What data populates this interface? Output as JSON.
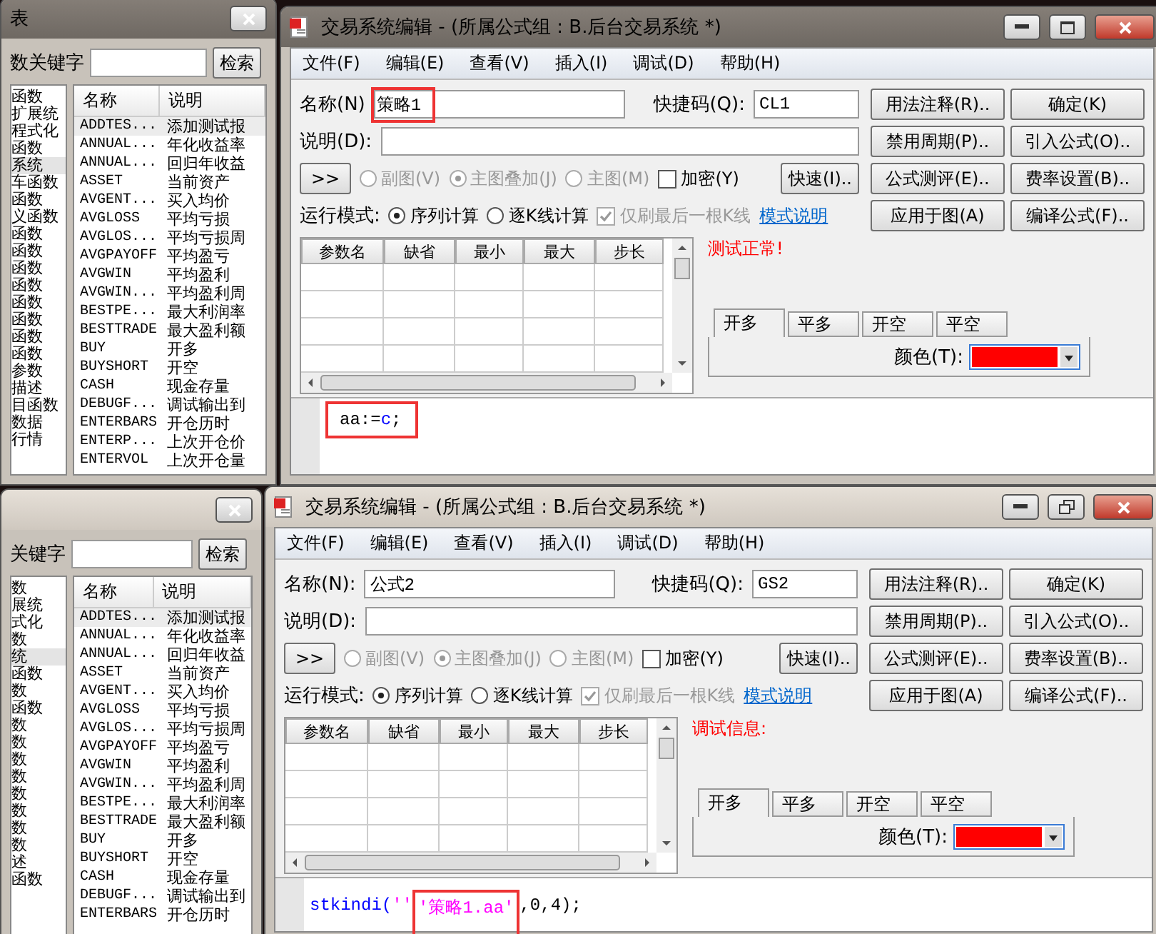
{
  "function_panels": [
    {
      "title": "表",
      "search_label": "数关键字",
      "search_button": "检索",
      "tree_items": [
        {
          "label": "函数",
          "selected": false
        },
        {
          "label": "扩展统",
          "selected": false
        },
        {
          "label": "程式化",
          "selected": false
        },
        {
          "label": "函数",
          "selected": false
        },
        {
          "label": "系统",
          "selected": true
        },
        {
          "label": "车函数",
          "selected": false
        },
        {
          "label": "函数",
          "selected": false
        },
        {
          "label": "义函数",
          "selected": false
        },
        {
          "label": "函数",
          "selected": false
        },
        {
          "label": "函数",
          "selected": false
        },
        {
          "label": "函数",
          "selected": false
        },
        {
          "label": "函数",
          "selected": false
        },
        {
          "label": "函数",
          "selected": false
        },
        {
          "label": "函数",
          "selected": false
        },
        {
          "label": "函数",
          "selected": false
        },
        {
          "label": "函数",
          "selected": false
        },
        {
          "label": "参数",
          "selected": false
        },
        {
          "label": "描述",
          "selected": false
        },
        {
          "label": "目函数",
          "selected": false
        },
        {
          "label": "数据",
          "selected": false
        },
        {
          "label": "行情",
          "selected": false
        }
      ],
      "columns": [
        "名称",
        "说明"
      ],
      "rows": [
        {
          "name": "ADDTES...",
          "desc": "添加测试报",
          "selected": true
        },
        {
          "name": "ANNUAL...",
          "desc": "年化收益率",
          "selected": false
        },
        {
          "name": "ANNUAL...",
          "desc": "回归年收益",
          "selected": false
        },
        {
          "name": "ASSET",
          "desc": "当前资产",
          "selected": false
        },
        {
          "name": "AVGENT...",
          "desc": "买入均价",
          "selected": false
        },
        {
          "name": "AVGLOSS",
          "desc": "平均亏损",
          "selected": false
        },
        {
          "name": "AVGLOS...",
          "desc": "平均亏损周",
          "selected": false
        },
        {
          "name": "AVGPAYOFF",
          "desc": "平均盈亏",
          "selected": false
        },
        {
          "name": "AVGWIN",
          "desc": "平均盈利",
          "selected": false
        },
        {
          "name": "AVGWIN...",
          "desc": "平均盈利周",
          "selected": false
        },
        {
          "name": "BESTPE...",
          "desc": "最大利润率",
          "selected": false
        },
        {
          "name": "BESTTRADE",
          "desc": "最大盈利额",
          "selected": false
        },
        {
          "name": "BUY",
          "desc": "开多",
          "selected": false
        },
        {
          "name": "BUYSHORT",
          "desc": "开空",
          "selected": false
        },
        {
          "name": "CASH",
          "desc": "现金存量",
          "selected": false
        },
        {
          "name": "DEBUGF...",
          "desc": "调试输出到",
          "selected": false
        },
        {
          "name": "ENTERBARS",
          "desc": "开仓历时",
          "selected": false
        },
        {
          "name": "ENTERP...",
          "desc": "上次开仓价",
          "selected": false
        },
        {
          "name": "ENTERVOL",
          "desc": "上次开仓量",
          "selected": false
        }
      ]
    },
    {
      "search_label": "关键字",
      "search_button": "检索",
      "tree_items": [
        {
          "label": "数",
          "selected": false
        },
        {
          "label": "展统",
          "selected": false
        },
        {
          "label": "式化",
          "selected": false
        },
        {
          "label": "数",
          "selected": false
        },
        {
          "label": "统",
          "selected": true
        },
        {
          "label": "函数",
          "selected": false
        },
        {
          "label": "数",
          "selected": false
        },
        {
          "label": "函数",
          "selected": false
        },
        {
          "label": "数",
          "selected": false
        },
        {
          "label": "数",
          "selected": false
        },
        {
          "label": "数",
          "selected": false
        },
        {
          "label": "数",
          "selected": false
        },
        {
          "label": "数",
          "selected": false
        },
        {
          "label": "数",
          "selected": false
        },
        {
          "label": "数",
          "selected": false
        },
        {
          "label": "数",
          "selected": false
        },
        {
          "label": "述",
          "selected": false
        },
        {
          "label": "函数",
          "selected": false
        }
      ],
      "columns": [
        "名称",
        "说明"
      ],
      "rows": [
        {
          "name": "ADDTES...",
          "desc": "添加测试报",
          "selected": true
        },
        {
          "name": "ANNUAL...",
          "desc": "年化收益率",
          "selected": false
        },
        {
          "name": "ANNUAL...",
          "desc": "回归年收益",
          "selected": false
        },
        {
          "name": "ASSET",
          "desc": "当前资产",
          "selected": false
        },
        {
          "name": "AVGENT...",
          "desc": "买入均价",
          "selected": false
        },
        {
          "name": "AVGLOSS",
          "desc": "平均亏损",
          "selected": false
        },
        {
          "name": "AVGLOS...",
          "desc": "平均亏损周",
          "selected": false
        },
        {
          "name": "AVGPAYOFF",
          "desc": "平均盈亏",
          "selected": false
        },
        {
          "name": "AVGWIN",
          "desc": "平均盈利",
          "selected": false
        },
        {
          "name": "AVGWIN...",
          "desc": "平均盈利周",
          "selected": false
        },
        {
          "name": "BESTPE...",
          "desc": "最大利润率",
          "selected": false
        },
        {
          "name": "BESTTRADE",
          "desc": "最大盈利额",
          "selected": false
        },
        {
          "name": "BUY",
          "desc": "开多",
          "selected": false
        },
        {
          "name": "BUYSHORT",
          "desc": "开空",
          "selected": false
        },
        {
          "name": "CASH",
          "desc": "现金存量",
          "selected": false
        },
        {
          "name": "DEBUGF...",
          "desc": "调试输出到",
          "selected": false
        },
        {
          "name": "ENTERBARS",
          "desc": "开仓历时",
          "selected": false
        }
      ]
    }
  ],
  "editors": [
    {
      "title": "交易系统编辑 - (所属公式组 : B.后台交易系统 *)",
      "restore_button": false,
      "active": false,
      "menu": [
        "文件(F)",
        "编辑(E)",
        "查看(V)",
        "插入(I)",
        "调试(D)",
        "帮助(H)"
      ],
      "name_label": "名称(N)",
      "name_value": "策略1",
      "name_highlight": true,
      "shortcut_label": "快捷码(Q):",
      "shortcut_value": "CL1",
      "desc_label": "说明(D):",
      "expand_button": ">>",
      "chart_options": [
        {
          "label": "副图(V)",
          "selected": false
        },
        {
          "label": "主图叠加(J)",
          "selected": true
        },
        {
          "label": "主图(M)",
          "selected": false
        }
      ],
      "encrypt": {
        "label": "加密(Y)",
        "checked": false
      },
      "fast_button": "快速(I)..",
      "buttons": [
        "用法注释(R)..",
        "确定(K)",
        "禁用周期(P)..",
        "引入公式(O)..",
        "公式测评(E)..",
        "费率设置(B)..",
        "应用于图(A)",
        "编译公式(F).."
      ],
      "run_mode_label": "运行模式:",
      "run_modes": [
        {
          "label": "序列计算",
          "selected": true
        },
        {
          "label": "逐K线计算",
          "selected": false
        }
      ],
      "refresh_last": {
        "label": "仅刷最后一根K线",
        "checked": true
      },
      "mode_link": "模式说明",
      "param_columns": [
        "参数名",
        "缺省",
        "最小",
        "最大",
        "步长"
      ],
      "message": "测试正常!",
      "tabs": [
        {
          "label": "开多",
          "selected": true
        },
        {
          "label": "平多",
          "selected": false
        },
        {
          "label": "开空",
          "selected": false
        },
        {
          "label": "平空",
          "selected": false
        }
      ],
      "color_label": "颜色(T):",
      "color": "#ff0000",
      "code_highlight": true,
      "code": [
        {
          "text": "aa:=",
          "color": "#000000",
          "highlight": false
        },
        {
          "text": "c",
          "color": "#0000ff",
          "highlight": false
        },
        {
          "text": ";",
          "color": "#000000",
          "highlight": false
        }
      ]
    },
    {
      "title": "交易系统编辑 - (所属公式组 : B.后台交易系统 *)",
      "restore_button": true,
      "active": true,
      "menu": [
        "文件(F)",
        "编辑(E)",
        "查看(V)",
        "插入(I)",
        "调试(D)",
        "帮助(H)"
      ],
      "name_label": "名称(N):",
      "name_value": "公式2",
      "name_highlight": false,
      "shortcut_label": "快捷码(Q):",
      "shortcut_value": "GS2",
      "desc_label": "说明(D):",
      "expand_button": ">>",
      "chart_options": [
        {
          "label": "副图(V)",
          "selected": false
        },
        {
          "label": "主图叠加(J)",
          "selected": true
        },
        {
          "label": "主图(M)",
          "selected": false
        }
      ],
      "encrypt": {
        "label": "加密(Y)",
        "checked": false
      },
      "fast_button": "快速(I)..",
      "buttons": [
        "用法注释(R)..",
        "确定(K)",
        "禁用周期(P)..",
        "引入公式(O)..",
        "公式测评(E)..",
        "费率设置(B)..",
        "应用于图(A)",
        "编译公式(F).."
      ],
      "run_mode_label": "运行模式:",
      "run_modes": [
        {
          "label": "序列计算",
          "selected": true
        },
        {
          "label": "逐K线计算",
          "selected": false
        }
      ],
      "refresh_last": {
        "label": "仅刷最后一根K线",
        "checked": true
      },
      "mode_link": "模式说明",
      "param_columns": [
        "参数名",
        "缺省",
        "最小",
        "最大",
        "步长"
      ],
      "message": "调试信息:",
      "tabs": [
        {
          "label": "开多",
          "selected": true
        },
        {
          "label": "平多",
          "selected": false
        },
        {
          "label": "开空",
          "selected": false
        },
        {
          "label": "平空",
          "selected": false
        }
      ],
      "color_label": "颜色(T):",
      "color": "#ff0000",
      "code_highlight": false,
      "code": [
        {
          "text": "stkindi(",
          "color": "#0000ff",
          "highlight": false
        },
        {
          "text": "''",
          "color": "#ff00ff",
          "highlight": false
        },
        {
          "text": "'策略1.aa'",
          "color": "#ff00ff",
          "highlight": true
        },
        {
          "text": ",0,4);",
          "color": "#000000",
          "highlight": false
        }
      ]
    }
  ]
}
